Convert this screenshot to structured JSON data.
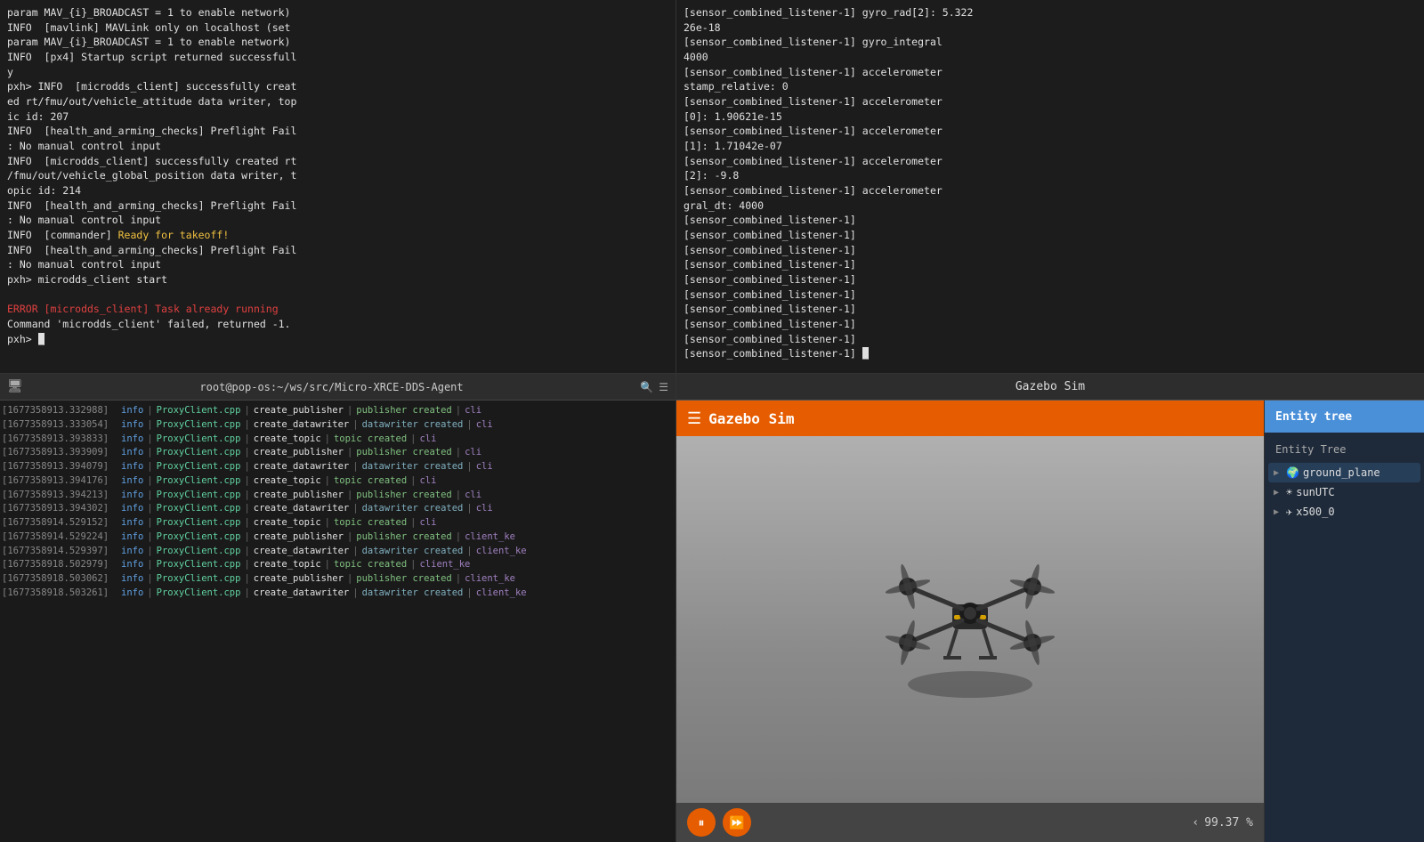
{
  "layout": {
    "topleft_terminal": {
      "lines": [
        {
          "text": "param MAV_{i}_BROADCAST = 1 to enable network)",
          "color": "white"
        },
        {
          "text": "INFO  [mavlink] MAVLink only on localhost (set",
          "color": "white"
        },
        {
          "text": "param MAV_{i}_BROADCAST = 1 to enable network)",
          "color": "white"
        },
        {
          "text": "INFO  [px4] Startup script returned successfull",
          "color": "white"
        },
        {
          "text": "y",
          "color": "white"
        },
        {
          "text": "pxh> INFO  [microdds_client] successfully creat",
          "color": "white"
        },
        {
          "text": "ed rt/fmu/out/vehicle_attitude data writer, top",
          "color": "white"
        },
        {
          "text": "ic id: 207",
          "color": "white"
        },
        {
          "text": "INFO  [health_and_arming_checks] Preflight Fail",
          "color": "white"
        },
        {
          "text": ": No manual control input",
          "color": "white"
        },
        {
          "text": "INFO  [microdds_client] successfully created rt",
          "color": "white"
        },
        {
          "text": "/fmu/out/vehicle_global_position data writer, t",
          "color": "white"
        },
        {
          "text": "opic id: 214",
          "color": "white"
        },
        {
          "text": "INFO  [health_and_arming_checks] Preflight Fail",
          "color": "white"
        },
        {
          "text": ": No manual control input",
          "color": "white"
        },
        {
          "text": "INFO  [commander] Ready for takeoff!",
          "color": "mixed1"
        },
        {
          "text": "INFO  [health_and_arming_checks] Preflight Fail",
          "color": "white"
        },
        {
          "text": ": No manual control input",
          "color": "white"
        },
        {
          "text": "pxh> microdds_client start",
          "color": "white"
        },
        {
          "text": "",
          "color": "white"
        },
        {
          "text": "ERROR [microdds_client] Task already running",
          "color": "error"
        },
        {
          "text": "Command 'microdds_client' failed, returned -1.",
          "color": "white"
        },
        {
          "text": "pxh> _",
          "color": "white"
        }
      ]
    },
    "topright_terminal": {
      "lines": [
        "[sensor_combined_listener-1] gyro_rad[2]: 5.322",
        "26e-18",
        "[sensor_combined_listener-1] gyro_integral",
        "4000",
        "[sensor_combined_listener-1] accelerometer",
        "stamp_relative: 0",
        "[sensor_combined_listener-1] accelerometer",
        "[0]: 1.90621e-15",
        "[sensor_combined_listener-1] accelerometer",
        "[1]: 1.71042e-07",
        "[sensor_combined_listener-1] accelerometer",
        "[2]: -9.8",
        "[sensor_combined_listener-1] accelerometer",
        "gral_dt: 4000",
        "[sensor_combined_listener-1]",
        "[sensor_combined_listener-1]",
        "[sensor_combined_listener-1]",
        "[sensor_combined_listener-1]",
        "[sensor_combined_listener-1]",
        "[sensor_combined_listener-1]",
        "[sensor_combined_listener-1]",
        "[sensor_combined_listener-1]",
        "[sensor_combined_listener-1]",
        "[sensor_combined_listener-1] _"
      ]
    },
    "bottom_terminal": {
      "titlebar": "root@pop-os:~/ws/src/Micro-XRCE-DDS-Agent",
      "rows": [
        {
          "ts": "[1677358913.332988]",
          "level": "info",
          "source": "ProxyClient.cpp",
          "action": "create_publisher",
          "result": "publisher created",
          "extra": "cli"
        },
        {
          "ts": "[1677358913.333054]",
          "level": "info",
          "source": "ProxyClient.cpp",
          "action": "create_datawriter",
          "result": "datawriter created",
          "extra": "cli"
        },
        {
          "ts": "[1677358913.393833]",
          "level": "info",
          "source": "ProxyClient.cpp",
          "action": "create_topic",
          "result": "topic created",
          "extra": "cli"
        },
        {
          "ts": "[1677358913.393909]",
          "level": "info",
          "source": "ProxyClient.cpp",
          "action": "create_publisher",
          "result": "publisher created",
          "extra": "cli"
        },
        {
          "ts": "[1677358913.394079]",
          "level": "info",
          "source": "ProxyClient.cpp",
          "action": "create_datawriter",
          "result": "datawriter created",
          "extra": "cli"
        },
        {
          "ts": "[1677358913.394176]",
          "level": "info",
          "source": "ProxyClient.cpp",
          "action": "create_topic",
          "result": "topic created",
          "extra": "cli"
        },
        {
          "ts": "[1677358913.394213]",
          "level": "info",
          "source": "ProxyClient.cpp",
          "action": "create_publisher",
          "result": "publisher created",
          "extra": "cli"
        },
        {
          "ts": "[1677358913.394302]",
          "level": "info",
          "source": "ProxyClient.cpp",
          "action": "create_datawriter",
          "result": "datawriter created",
          "extra": "cli"
        },
        {
          "ts": "[1677358914.529152]",
          "level": "info",
          "source": "ProxyClient.cpp",
          "action": "create_topic",
          "result": "topic created",
          "extra": "cli"
        },
        {
          "ts": "[1677358914.529224]",
          "level": "info",
          "source": "ProxyClient.cpp",
          "action": "create_publisher",
          "result": "publisher created",
          "extra": "client_ke"
        },
        {
          "ts": "[1677358914.529397]",
          "level": "info",
          "source": "ProxyClient.cpp",
          "action": "create_datawriter",
          "result": "datawriter created",
          "extra": "client_ke"
        },
        {
          "ts": "[1677358918.502979]",
          "level": "info",
          "source": "ProxyClient.cpp",
          "action": "create_topic",
          "result": "topic created",
          "extra": "client_ke"
        },
        {
          "ts": "[1677358918.503062]",
          "level": "info",
          "source": "ProxyClient.cpp",
          "action": "create_publisher",
          "result": "publisher created",
          "extra": "client_ke"
        },
        {
          "ts": "[1677358918.503261]",
          "level": "info",
          "source": "ProxyClient.cpp",
          "action": "create_datawriter",
          "result": "datawriter created",
          "extra": "client_ke"
        }
      ]
    },
    "gazebo": {
      "window_title": "Gazebo Sim",
      "toolbar_title": "Gazebo Sim",
      "entity_tree_header": "Entity tree",
      "entity_tree_label": "Entity Tree",
      "entities": [
        {
          "name": "ground_plane",
          "icon": "🌍",
          "selected": true,
          "arrow": "▶"
        },
        {
          "name": "sunUTC",
          "icon": "☀",
          "selected": false,
          "arrow": "▶"
        },
        {
          "name": "x500_0",
          "icon": "✈",
          "selected": false,
          "arrow": "▶"
        }
      ],
      "controls": {
        "pause_label": "⏸",
        "forward_label": "⏩"
      },
      "zoom": "99.37 %",
      "zoom_arrow": "‹"
    }
  }
}
